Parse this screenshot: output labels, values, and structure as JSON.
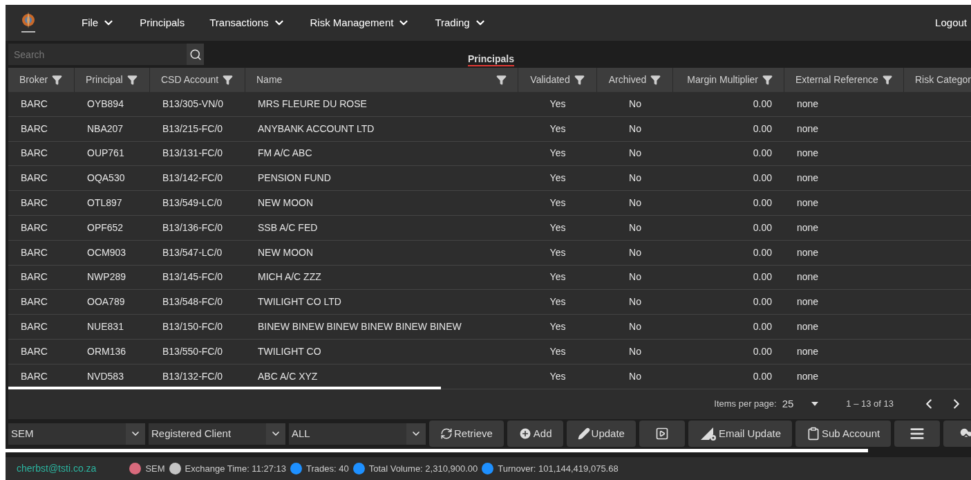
{
  "nav": {
    "items": [
      {
        "label": "File",
        "dropdown": true
      },
      {
        "label": "Principals",
        "dropdown": false
      },
      {
        "label": "Transactions",
        "dropdown": true
      },
      {
        "label": "Risk Management",
        "dropdown": true
      },
      {
        "label": "Trading",
        "dropdown": true
      }
    ],
    "logout": "Logout"
  },
  "search": {
    "placeholder": "Search"
  },
  "page_title": "Principals",
  "table": {
    "columns": [
      {
        "label": "Broker",
        "filter": true
      },
      {
        "label": "Principal",
        "filter": true
      },
      {
        "label": "CSD Account",
        "filter": true
      },
      {
        "label": "Name",
        "filter": true
      },
      {
        "label": "Validated",
        "filter": true
      },
      {
        "label": "Archived",
        "filter": true
      },
      {
        "label": "Margin Multiplier",
        "filter": true
      },
      {
        "label": "External Reference",
        "filter": true
      },
      {
        "label": "Risk Categor",
        "filter": false
      }
    ],
    "rows": [
      [
        "BARC",
        "OYB894",
        "B13/305-VN/0",
        "MRS FLEURE DU ROSE",
        "Yes",
        "No",
        "0.00",
        "none"
      ],
      [
        "BARC",
        "NBA207",
        "B13/215-FC/0",
        "ANYBANK ACCOUNT LTD",
        "Yes",
        "No",
        "0.00",
        "none"
      ],
      [
        "BARC",
        "OUP761",
        "B13/131-FC/0",
        "FM A/C ABC",
        "Yes",
        "No",
        "0.00",
        "none"
      ],
      [
        "BARC",
        "OQA530",
        "B13/142-FC/0",
        "PENSION FUND",
        "Yes",
        "No",
        "0.00",
        "none"
      ],
      [
        "BARC",
        "OTL897",
        "B13/549-LC/0",
        "NEW MOON",
        "Yes",
        "No",
        "0.00",
        "none"
      ],
      [
        "BARC",
        "OPF652",
        "B13/136-FC/0",
        "SSB A/C FED",
        "Yes",
        "No",
        "0.00",
        "none"
      ],
      [
        "BARC",
        "OCM903",
        "B13/547-LC/0",
        "NEW MOON",
        "Yes",
        "No",
        "0.00",
        "none"
      ],
      [
        "BARC",
        "NWP289",
        "B13/145-FC/0",
        "MICH A/C ZZZ",
        "Yes",
        "No",
        "0.00",
        "none"
      ],
      [
        "BARC",
        "OOA789",
        "B13/548-FC/0",
        "TWILIGHT CO LTD",
        "Yes",
        "No",
        "0.00",
        "none"
      ],
      [
        "BARC",
        "NUE831",
        "B13/150-FC/0",
        "BINEW BINEW BINEW BINEW BINEW BINEW",
        "Yes",
        "No",
        "0.00",
        "none"
      ],
      [
        "BARC",
        "ORM136",
        "B13/550-FC/0",
        "TWILIGHT CO",
        "Yes",
        "No",
        "0.00",
        "none"
      ],
      [
        "BARC",
        "NVD583",
        "B13/132-FC/0",
        "ABC A/C XYZ",
        "Yes",
        "No",
        "0.00",
        "none"
      ]
    ]
  },
  "pagination": {
    "items_per_page_label": "Items per page:",
    "items_per_page": "25",
    "range": "1 – 13 of 13"
  },
  "filters": [
    {
      "value": "SEM"
    },
    {
      "value": "Registered Client"
    },
    {
      "value": "ALL"
    }
  ],
  "actions": [
    {
      "kind": "retrieve",
      "label": "Retrieve"
    },
    {
      "kind": "add",
      "label": "Add"
    },
    {
      "kind": "update",
      "label": "Update"
    },
    {
      "kind": "play"
    },
    {
      "kind": "email",
      "label": "Email Update"
    },
    {
      "kind": "sub",
      "label": "Sub Account"
    },
    {
      "kind": "list"
    },
    {
      "kind": "upload"
    }
  ],
  "status_bar": {
    "user": "cherbst@tsti.co.za",
    "items": [
      {
        "text": "SEM",
        "color": "#d96a7c"
      },
      {
        "text": "Exchange Time: 11:27:13",
        "color": "#c4c4c4"
      },
      {
        "text": "Trades: 40",
        "color": "#1e90ff"
      },
      {
        "text": "Total Volume: 2,310,900.00",
        "color": "#1e90ff"
      },
      {
        "text": "Turnover: 101,144,419,075.68",
        "color": "#1e90ff"
      }
    ]
  }
}
